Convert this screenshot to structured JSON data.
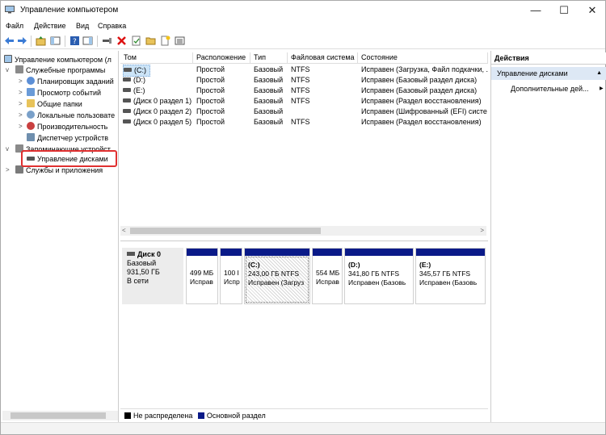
{
  "window": {
    "title": "Управление компьютером",
    "minimize_glyph": "—",
    "maximize_glyph": "☐",
    "close_glyph": "✕"
  },
  "menu": [
    "Файл",
    "Действие",
    "Вид",
    "Справка"
  ],
  "tree": {
    "root": "Управление компьютером (л",
    "items": [
      {
        "label": "Служебные программы",
        "icon": "tools-icon"
      },
      {
        "label": "Планировщик заданий",
        "icon": "clock-icon"
      },
      {
        "label": "Просмотр событий",
        "icon": "event-viewer-icon"
      },
      {
        "label": "Общие папки",
        "icon": "shared-folder-icon"
      },
      {
        "label": "Локальные пользовате",
        "icon": "users-icon"
      },
      {
        "label": "Производительность",
        "icon": "performance-icon"
      },
      {
        "label": "Диспетчер устройств",
        "icon": "device-manager-icon"
      },
      {
        "label": "Запоминающие устройст",
        "icon": "storage-icon"
      },
      {
        "label": "Управление дисками",
        "icon": "disk-icon"
      },
      {
        "label": "Службы и приложения",
        "icon": "services-icon"
      }
    ]
  },
  "volumes": {
    "columns": [
      "Том",
      "Расположение",
      "Тип",
      "Файловая система",
      "Состояние"
    ],
    "rows": [
      [
        "(C:)",
        "Простой",
        "Базовый",
        "NTFS",
        "Исправен (Загрузка, Файл подкачки, ..."
      ],
      [
        "(D:)",
        "Простой",
        "Базовый",
        "NTFS",
        "Исправен (Базовый раздел диска)"
      ],
      [
        "(E:)",
        "Простой",
        "Базовый",
        "NTFS",
        "Исправен (Базовый раздел диска)"
      ],
      [
        "(Диск 0 раздел 1)",
        "Простой",
        "Базовый",
        "NTFS",
        "Исправен (Раздел восстановления)"
      ],
      [
        "(Диск 0 раздел 2)",
        "Простой",
        "Базовый",
        "",
        "Исправен (Шифрованный (EFI) систе"
      ],
      [
        "(Диск 0 раздел 5)",
        "Простой",
        "Базовый",
        "NTFS",
        "Исправен (Раздел восстановления)"
      ]
    ]
  },
  "disk": {
    "name": "Диск 0",
    "type": "Базовый",
    "size": "931,50 ГБ",
    "status": "В сети",
    "partitions": [
      {
        "title": "",
        "size": "499 МБ",
        "status": "Исправ"
      },
      {
        "title": "",
        "size": "100 I",
        "status": "Испр"
      },
      {
        "title": "(C:)",
        "size": "243,00 ГБ NTFS",
        "status": "Исправен (Загруз"
      },
      {
        "title": "",
        "size": "554 МБ",
        "status": "Исправ"
      },
      {
        "title": "(D:)",
        "size": "341,80 ГБ NTFS",
        "status": "Исправен (Базовь"
      },
      {
        "title": "(E:)",
        "size": "345,57 ГБ NTFS",
        "status": "Исправен (Базовь"
      }
    ]
  },
  "legend": {
    "unallocated": "Не распределена",
    "primary": "Основной раздел",
    "unallocated_color": "#000000",
    "primary_color": "#0a1a88"
  },
  "actions": {
    "header": "Действия",
    "section": "Управление дисками",
    "more": "Дополнительные дей..."
  }
}
